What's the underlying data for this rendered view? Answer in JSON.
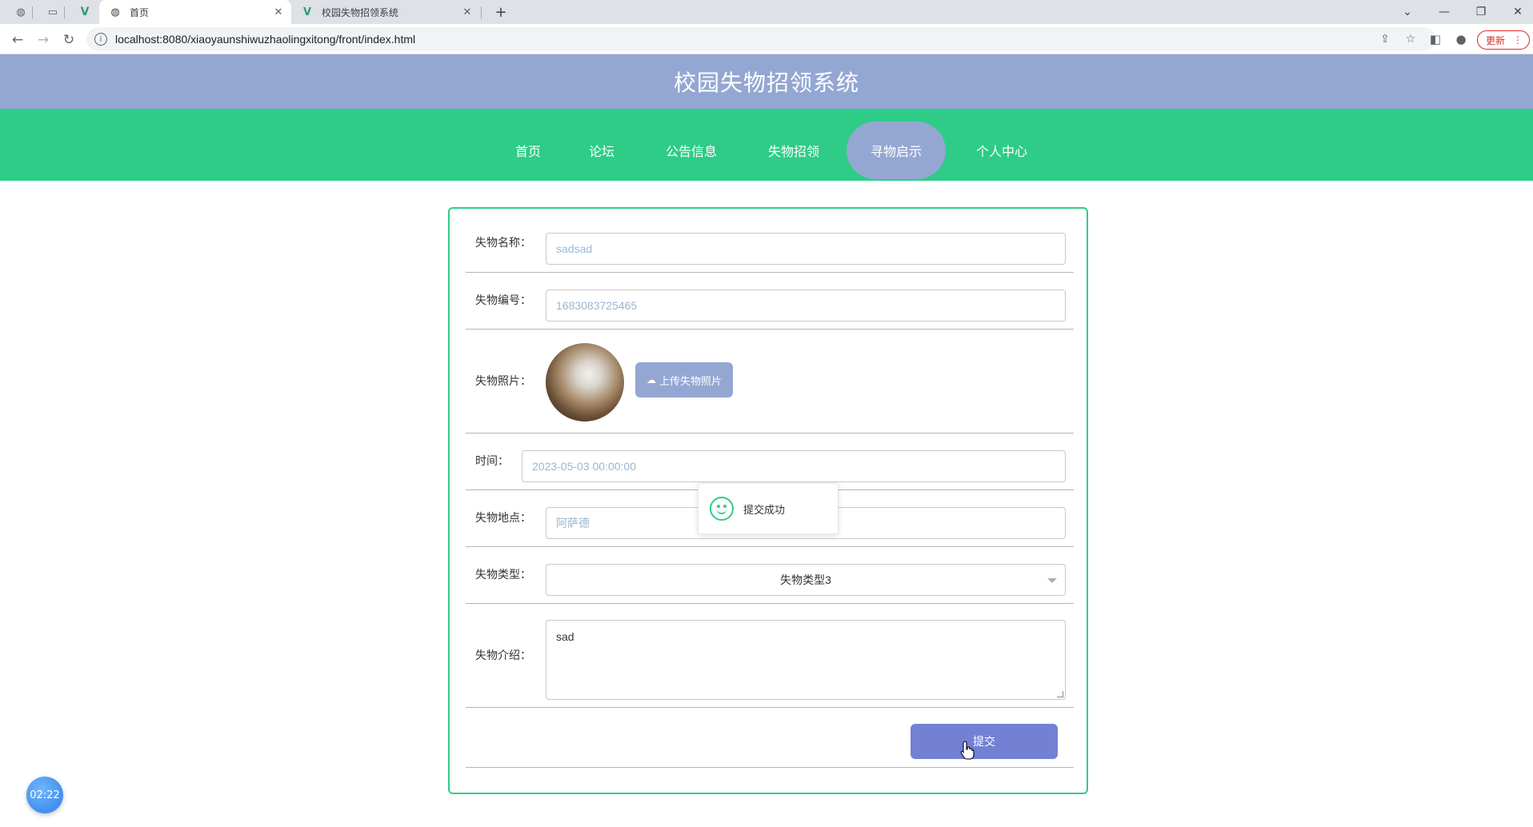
{
  "browser": {
    "tabs": [
      {
        "title": "首页",
        "active": true
      },
      {
        "title": "校园失物招领系统",
        "active": false
      }
    ],
    "url": "localhost:8080/xiaoyaunshiwuzhaolingxitong/front/index.html",
    "update_label": "更新"
  },
  "site": {
    "title": "校园失物招领系统"
  },
  "nav": {
    "items": [
      {
        "label": "首页"
      },
      {
        "label": "论坛"
      },
      {
        "label": "公告信息"
      },
      {
        "label": "失物招领"
      },
      {
        "label": "寻物启示",
        "active": true
      },
      {
        "label": "个人中心"
      }
    ]
  },
  "form": {
    "name": {
      "label": "失物名称：",
      "value": "sadsad"
    },
    "number": {
      "label": "失物编号：",
      "value": "1683083725465"
    },
    "photo": {
      "label": "失物照片：",
      "upload_label": "上传失物照片"
    },
    "time": {
      "label": "时间：",
      "value": "2023-05-03 00:00:00"
    },
    "location": {
      "label": "失物地点：",
      "value": "阿萨德"
    },
    "type": {
      "label": "失物类型：",
      "selected": "失物类型3"
    },
    "description": {
      "label": "失物介绍：",
      "value": "sad"
    },
    "submit_label": "提交"
  },
  "toast": {
    "message": "提交成功"
  },
  "timer": {
    "value": "02:22"
  },
  "colors": {
    "header": "#94a7d3",
    "nav": "#2ecc87",
    "nav_active": "#94a7d3",
    "submit": "#7281d4",
    "card_border": "#2ecc87"
  }
}
